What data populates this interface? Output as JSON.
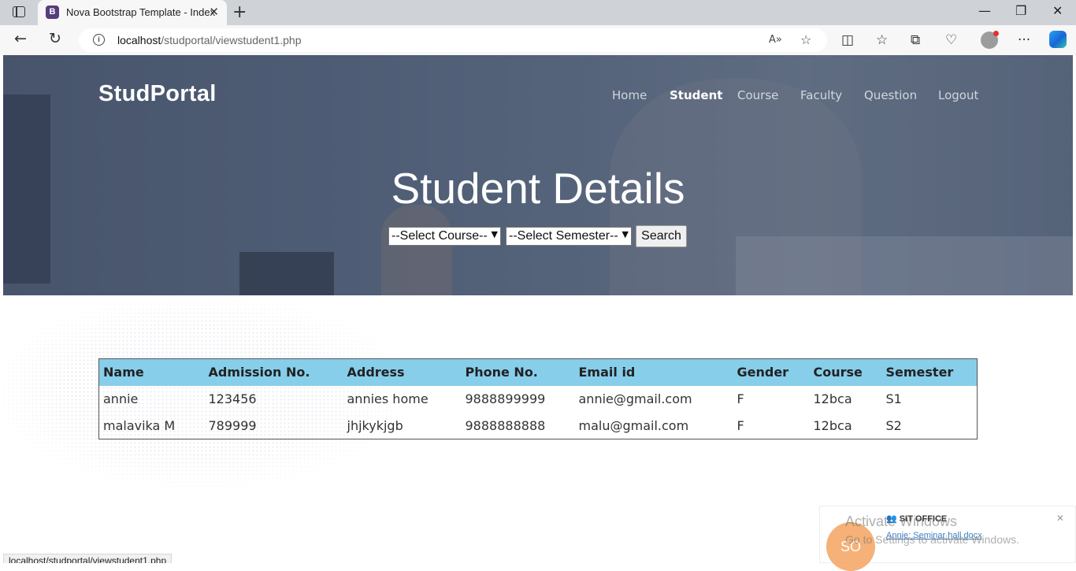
{
  "browser": {
    "tab_title": "Nova Bootstrap Template - Index",
    "favicon_letter": "B",
    "url_host": "localhost",
    "url_path": "/studportal/viewstudent1.php"
  },
  "site": {
    "brand": "StudPortal",
    "nav": [
      "Home",
      "Student",
      "Course",
      "Faculty",
      "Question",
      "Logout"
    ]
  },
  "hero": {
    "title": "Student Details",
    "course_select": "--Select Course--",
    "semester_select": "--Select Semester--",
    "search_label": "Search"
  },
  "table": {
    "headers": [
      "Name",
      "Admission No.",
      "Address",
      "Phone No.",
      "Email id",
      "Gender",
      "Course",
      "Semester"
    ],
    "rows": [
      [
        "annie",
        "123456",
        "annies home",
        "9888899999",
        "annie@gmail.com",
        "F",
        "12bca",
        "S1"
      ],
      [
        "malavika M",
        "789999",
        "jhjkykjgb",
        "9888888888",
        "malu@gmail.com",
        "F",
        "12bca",
        "S2"
      ]
    ]
  },
  "status_url": "localhost/studportal/viewstudent1.php",
  "notification": {
    "avatar": "SO",
    "header": "SIT OFFICE",
    "body": "Annie: Seminar hall.docx"
  },
  "watermark": {
    "title": "Activate Windows",
    "subtitle": "Go to Settings to activate Windows."
  },
  "colors": {
    "table_header": "#87ceeb",
    "favicon": "#563d7c"
  }
}
